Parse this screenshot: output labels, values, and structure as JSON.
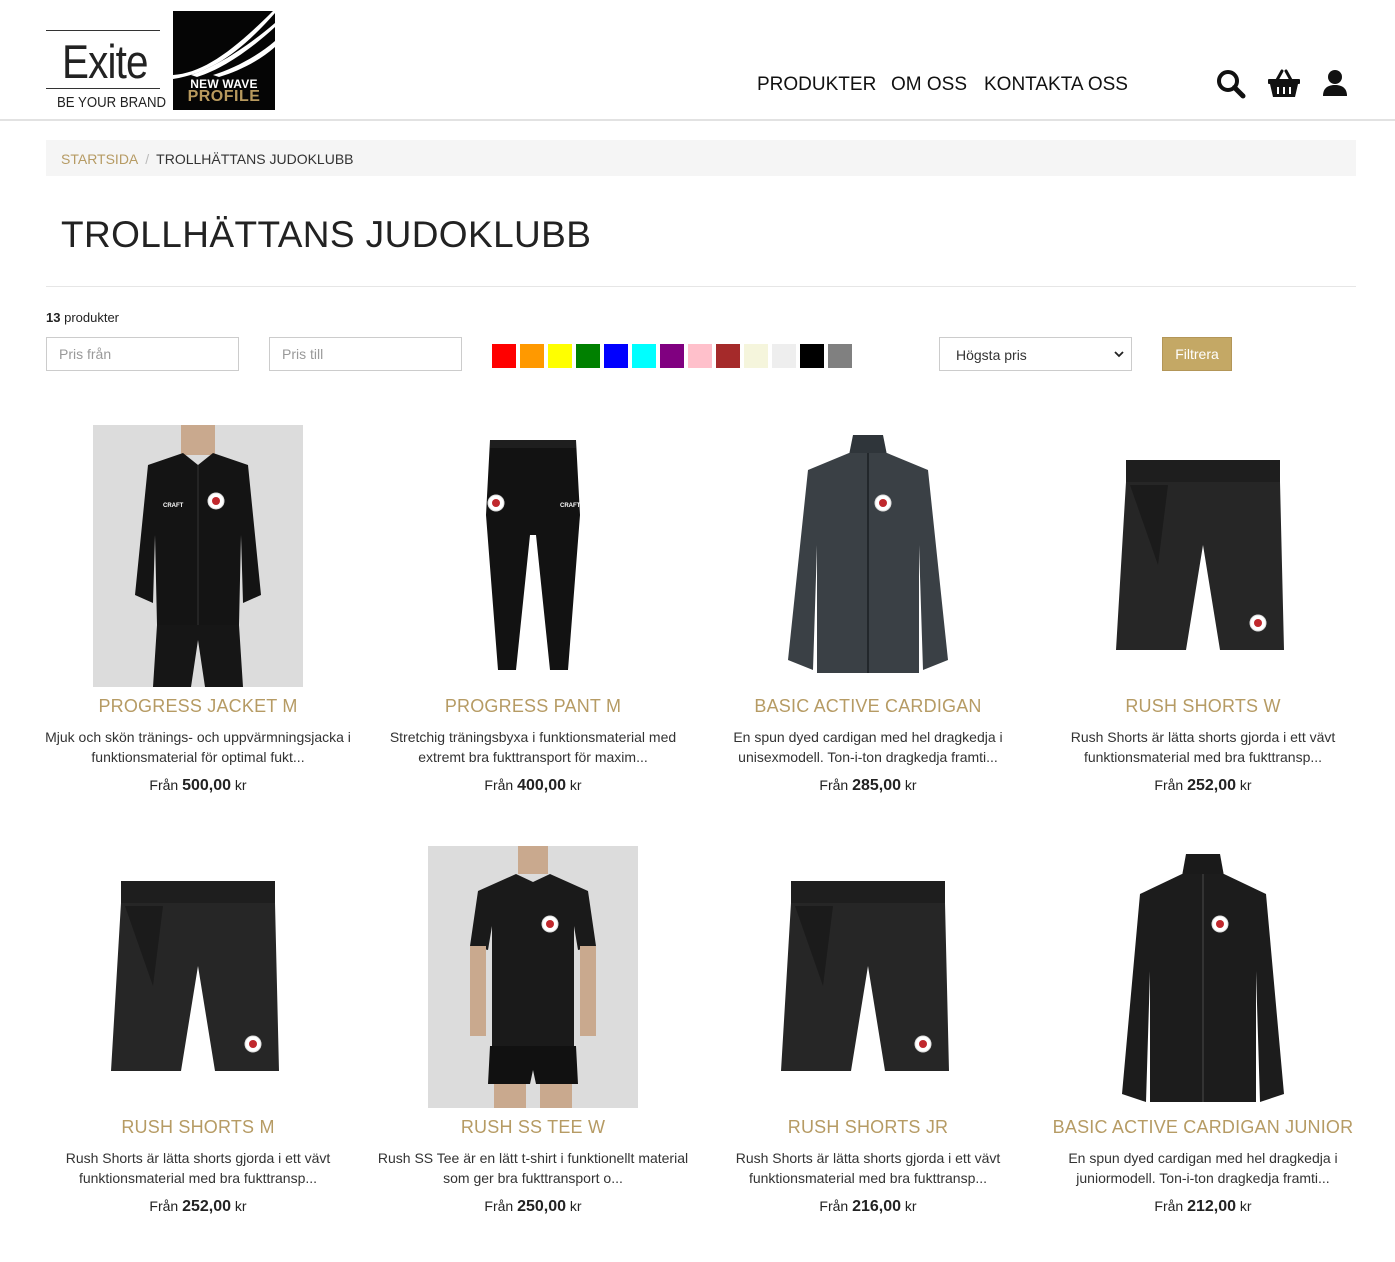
{
  "header": {
    "logo_exite_word": "Exite",
    "logo_exite_tag": "BE YOUR BRAND",
    "logo_nwp_line1": "NEW WAVE",
    "logo_nwp_line2": "PROFILE",
    "nav": [
      "PRODUKTER",
      "OM OSS",
      "KONTAKTA OSS"
    ],
    "icons": [
      "search-icon",
      "basket-icon",
      "user-icon"
    ]
  },
  "breadcrumb": {
    "home": "STARTSIDA",
    "separator": "/",
    "current": "TROLLHÄTTANS JUDOKLUBB"
  },
  "page_title": "TROLLHÄTTANS JUDOKLUBB",
  "product_count": {
    "number": "13",
    "label": "produkter"
  },
  "filters": {
    "price_from_placeholder": "Pris från",
    "price_to_placeholder": "Pris till",
    "colors": [
      "#ff0000",
      "#ff9900",
      "#ffff00",
      "#008000",
      "#0000ff",
      "#00ffff",
      "#800080",
      "#ffc0cb",
      "#a52a2a",
      "#f5f5dc",
      "#eeeeee",
      "#000000",
      "#808080"
    ],
    "sort_selected": "Högsta pris",
    "filter_button": "Filtrera"
  },
  "accent_color": "#b69b64",
  "products": [
    {
      "name": "PROGRESS JACKET M",
      "desc": "Mjuk och skön tränings- och uppvärmningsjacka i funktionsmaterial för optimal fukt...",
      "from": "Från",
      "price": "500,00",
      "currency": "kr",
      "image": "model-jacket"
    },
    {
      "name": "PROGRESS PANT M",
      "desc": "Stretchig träningsbyxa i funktionsmaterial med extremt bra fukttransport för maxim...",
      "from": "Från",
      "price": "400,00",
      "currency": "kr",
      "image": "pants"
    },
    {
      "name": "BASIC ACTIVE CARDIGAN",
      "desc": "En spun dyed cardigan med hel dragkedja i unisexmodell. Ton-i-ton dragkedja framti...",
      "from": "Från",
      "price": "285,00",
      "currency": "kr",
      "image": "cardigan-grey"
    },
    {
      "name": "RUSH SHORTS W",
      "desc": "Rush Shorts är lätta shorts gjorda i ett vävt funktionsmaterial med bra fukttransp...",
      "from": "Från",
      "price": "252,00",
      "currency": "kr",
      "image": "shorts"
    },
    {
      "name": "RUSH SHORTS M",
      "desc": "Rush Shorts är lätta shorts gjorda i ett vävt funktionsmaterial med bra fukttransp...",
      "from": "Från",
      "price": "252,00",
      "currency": "kr",
      "image": "shorts"
    },
    {
      "name": "RUSH SS TEE W",
      "desc": "Rush SS Tee är en lätt t-shirt i funktionellt material som ger bra fukttransport o...",
      "from": "Från",
      "price": "250,00",
      "currency": "kr",
      "image": "model-tee"
    },
    {
      "name": "RUSH SHORTS JR",
      "desc": "Rush Shorts är lätta shorts gjorda i ett vävt funktionsmaterial med bra fukttransp...",
      "from": "Från",
      "price": "216,00",
      "currency": "kr",
      "image": "shorts"
    },
    {
      "name": "BASIC ACTIVE CARDIGAN JUNIOR",
      "desc": "En spun dyed cardigan med hel dragkedja i juniormodell. Ton-i-ton dragkedja framti...",
      "from": "Från",
      "price": "212,00",
      "currency": "kr",
      "image": "cardigan-black"
    }
  ]
}
